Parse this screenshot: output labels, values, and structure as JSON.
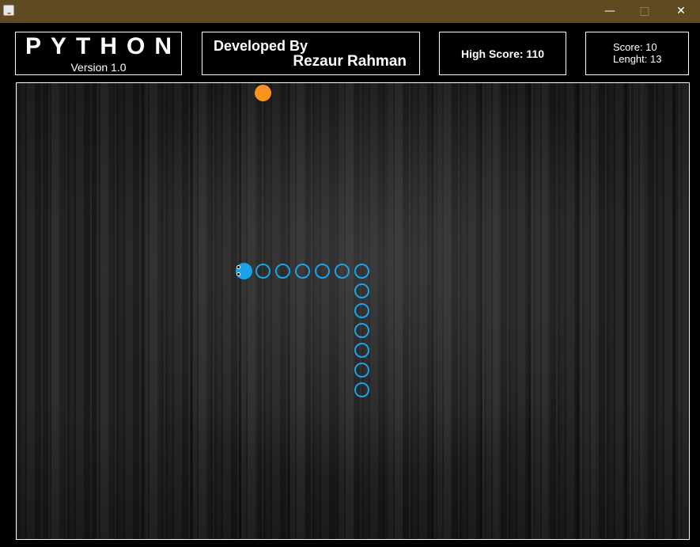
{
  "window": {
    "minimize_glyph": "—",
    "maximize_glyph": "□",
    "close_glyph": "✕",
    "titlebar_color": "#5f4a21"
  },
  "header": {
    "game_title": "PYTHON",
    "version": "Version 1.0",
    "developed_by": "Developed By",
    "developer": "Rezaur Rahman",
    "high_score": "High Score: 110",
    "score": "Score: 10",
    "length": "Lenght: 13"
  },
  "game": {
    "snake_color": "#1ba3e8",
    "food_color": "#f7931e",
    "snake_direction": "left",
    "snake_length": 13
  }
}
